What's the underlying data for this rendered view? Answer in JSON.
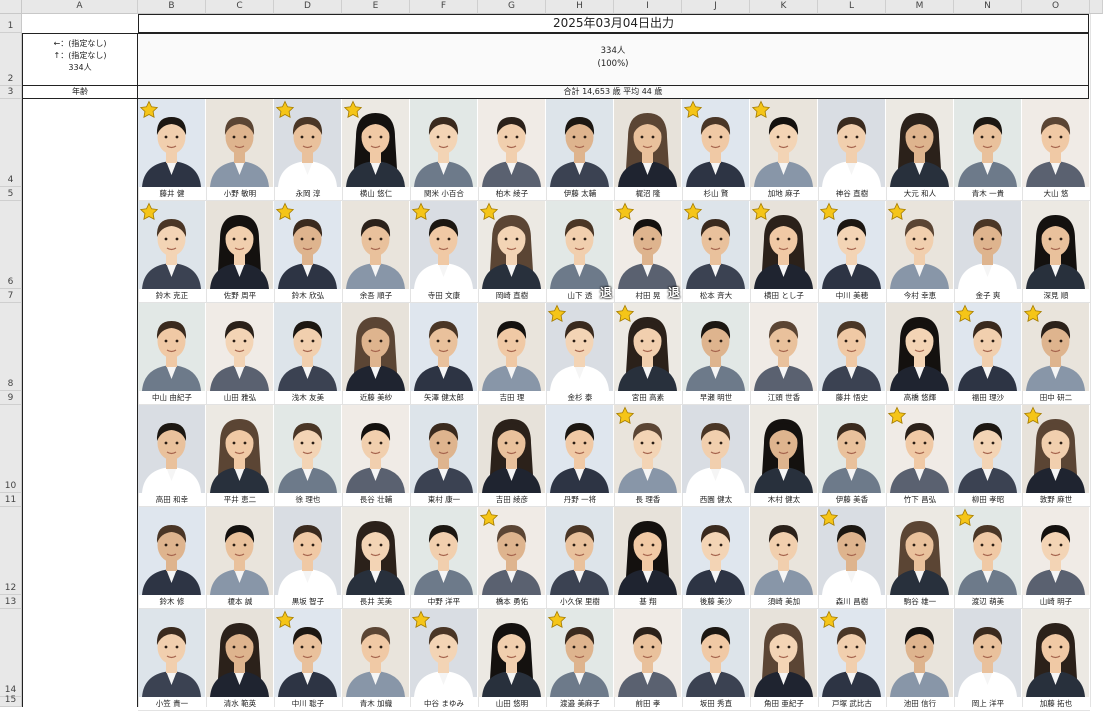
{
  "sheet": {
    "columns": [
      "A",
      "B",
      "C",
      "D",
      "E",
      "F",
      "G",
      "H",
      "I",
      "J",
      "K",
      "L",
      "M",
      "N",
      "O"
    ],
    "rows": [
      "1",
      "2",
      "3",
      "4",
      "5",
      "6",
      "7",
      "8",
      "9",
      "10",
      "11",
      "12",
      "13",
      "14",
      "15"
    ]
  },
  "header": {
    "title": "2025年03月04日出力",
    "filter_lines": [
      "←：(指定なし)",
      "↑：(指定なし)",
      "334人"
    ],
    "count_line1": "334人",
    "count_line2": "(100%)",
    "age_label": "年齢",
    "age_summary": "合計 14,653 歳  平均 44 歳"
  },
  "colors": {
    "star": "#f5c518",
    "border": "#222222",
    "header_bg": "#e8e8e8"
  },
  "people": [
    [
      {
        "name": "藤井 健",
        "star": true
      },
      {
        "name": "小野 敏明",
        "star": false
      },
      {
        "name": "永岡 淳",
        "star": true
      },
      {
        "name": "横山 悠仁",
        "star": true
      },
      {
        "name": "関米 小百合",
        "star": false
      },
      {
        "name": "柏木 綾子",
        "star": false
      },
      {
        "name": "伊藤 太輔",
        "star": false
      },
      {
        "name": "梶沼 隆",
        "star": false
      },
      {
        "name": "杉山 賢",
        "star": true
      },
      {
        "name": "加地 麻子",
        "star": true
      },
      {
        "name": "神谷 直樹",
        "star": false
      },
      {
        "name": "大元 和人",
        "star": false
      },
      {
        "name": "青木 一貴",
        "star": false
      },
      {
        "name": "大山 悠",
        "star": false
      }
    ],
    [
      {
        "name": "鈴木 克正",
        "star": true
      },
      {
        "name": "佐野 周平",
        "star": false
      },
      {
        "name": "鈴木 欣弘",
        "star": true
      },
      {
        "name": "余吾 順子",
        "star": false
      },
      {
        "name": "寺田 文康",
        "star": true
      },
      {
        "name": "岡崎 直樹",
        "star": true
      },
      {
        "name": "山下 透",
        "star": false,
        "retired": "退"
      },
      {
        "name": "村田 晃",
        "star": true,
        "retired": "退"
      },
      {
        "name": "松本 斉大",
        "star": true
      },
      {
        "name": "横田 とし子",
        "star": true
      },
      {
        "name": "中川 美穂",
        "star": true
      },
      {
        "name": "今村 幸恵",
        "star": true
      },
      {
        "name": "金子 爽",
        "star": false
      },
      {
        "name": "深見 順",
        "star": false
      }
    ],
    [
      {
        "name": "中山 由紀子",
        "star": false
      },
      {
        "name": "山田 雅弘",
        "star": false
      },
      {
        "name": "浅木 友美",
        "star": false
      },
      {
        "name": "近藤 美紗",
        "star": false
      },
      {
        "name": "矢澤 健太郎",
        "star": false
      },
      {
        "name": "吉田 理",
        "star": false
      },
      {
        "name": "金杉 泰",
        "star": true
      },
      {
        "name": "宮田 高素",
        "star": true
      },
      {
        "name": "早瀬 明世",
        "star": false
      },
      {
        "name": "江頭 世香",
        "star": false
      },
      {
        "name": "藤井 悟史",
        "star": false
      },
      {
        "name": "高橋 悠輝",
        "star": false
      },
      {
        "name": "福田 理沙",
        "star": true
      },
      {
        "name": "田中 研二",
        "star": true
      }
    ],
    [
      {
        "name": "高田 和幸",
        "star": false
      },
      {
        "name": "平井 恵二",
        "star": false
      },
      {
        "name": "徐 理也",
        "star": false
      },
      {
        "name": "長谷 壮輔",
        "star": false
      },
      {
        "name": "東村 康一",
        "star": false
      },
      {
        "name": "吉田 綾彦",
        "star": false
      },
      {
        "name": "丹野 一将",
        "star": false
      },
      {
        "name": "長 理香",
        "star": true
      },
      {
        "name": "西園 健太",
        "star": false
      },
      {
        "name": "木村 健太",
        "star": false
      },
      {
        "name": "伊藤 美香",
        "star": false
      },
      {
        "name": "竹下 昌弘",
        "star": true
      },
      {
        "name": "柳田 孝昭",
        "star": false
      },
      {
        "name": "敦野 麻世",
        "star": true
      }
    ],
    [
      {
        "name": "鈴木 修",
        "star": false
      },
      {
        "name": "榎本 誠",
        "star": false
      },
      {
        "name": "黒坂 智子",
        "star": false
      },
      {
        "name": "長井 芙美",
        "star": false
      },
      {
        "name": "中野 洋平",
        "star": false
      },
      {
        "name": "橋本 勇佑",
        "star": true
      },
      {
        "name": "小久保 里樹",
        "star": false
      },
      {
        "name": "基 翔",
        "star": false
      },
      {
        "name": "後藤 美沙",
        "star": false
      },
      {
        "name": "須崎 美加",
        "star": false
      },
      {
        "name": "森川 昌樹",
        "star": true
      },
      {
        "name": "駒谷 雄一",
        "star": false
      },
      {
        "name": "渡辺 萌美",
        "star": true
      },
      {
        "name": "山崎 明子",
        "star": false
      }
    ],
    [
      {
        "name": "小笠 貴一",
        "star": false
      },
      {
        "name": "清水 範英",
        "star": false
      },
      {
        "name": "中川 聡子",
        "star": true
      },
      {
        "name": "青木 加織",
        "star": false
      },
      {
        "name": "中谷 まゆみ",
        "star": true
      },
      {
        "name": "山田 悠明",
        "star": false
      },
      {
        "name": "渡邉 美麻子",
        "star": true
      },
      {
        "name": "前田 孝",
        "star": false
      },
      {
        "name": "坂田 秀直",
        "star": false
      },
      {
        "name": "角田 亜紀子",
        "star": false
      },
      {
        "name": "戸塚 武比古",
        "star": true
      },
      {
        "name": "池田 信行",
        "star": false
      },
      {
        "name": "岡上 洋平",
        "star": false
      },
      {
        "name": "加藤 拓也",
        "star": false
      }
    ]
  ]
}
